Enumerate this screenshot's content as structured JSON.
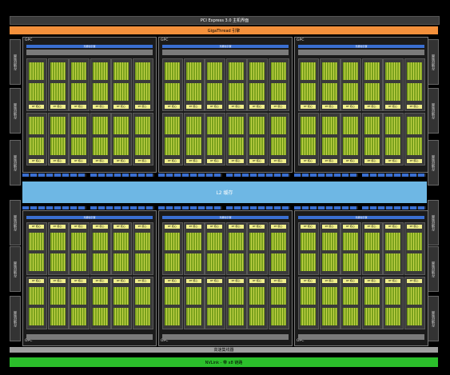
{
  "pcie_label": "PCI Express 3.0 主机界面",
  "gigathread_label": "GigaThread 引擎",
  "l2_label": "L2 缓存",
  "hub_label": "高速集线器",
  "nvlink_label": "NVLink - 带 x8 链路",
  "mem_controller_label": "存储控制器",
  "gpc_label": "GPC",
  "raster_label": "光栅化引擎",
  "rt_label": "RT 核心",
  "sm_label": "SM",
  "tpc_label": "TPC",
  "colors": {
    "accent_orange": "#f4903b",
    "l2_blue": "#6eb7e4",
    "nvlink_green": "#2bbf2b",
    "core_green": "#7aa21c",
    "rt_yellow": "#f0ef8b"
  }
}
